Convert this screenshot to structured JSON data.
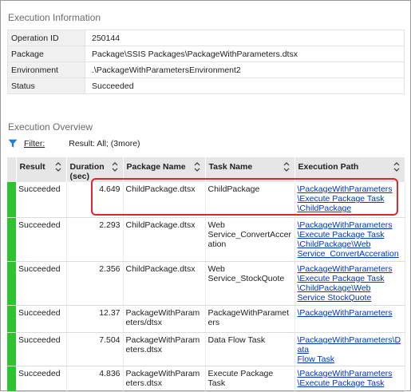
{
  "sections": {
    "info_title": "Execution Information",
    "overview_title": "Execution Overview"
  },
  "info": [
    {
      "key": "Operation ID",
      "value": "250144"
    },
    {
      "key": "Package",
      "value": "Package\\SSIS Packages\\PackageWithParameters.dtsx"
    },
    {
      "key": "Environment",
      "value": ".\\PackageWithParametersEnvironment2"
    },
    {
      "key": "Status",
      "value": "Succeeded"
    }
  ],
  "filter": {
    "icon": "filter-funnel-icon",
    "label": "Filter:",
    "value": "Result: All;  (3more)"
  },
  "grid": {
    "headers": [
      "Result",
      "Duration (sec)",
      "Package Name",
      "Task Name",
      "Execution Path"
    ],
    "rows": [
      {
        "result": "Succeeded",
        "duration": "4.649",
        "package": "ChildPackage.dtsx",
        "task": "ChildPackage",
        "path": [
          "\\PackageWithParameters",
          "\\Execute Package Task",
          "\\ChildPackage"
        ]
      },
      {
        "result": "Succeeded",
        "duration": "2.293",
        "package": "ChildPackage.dtsx",
        "task": "Web Service_ConvertAcceration",
        "path": [
          "\\PackageWithParameters",
          "\\Execute Package Task",
          "\\ChildPackage\\Web",
          "Service_ConvertAcceration"
        ]
      },
      {
        "result": "Succeeded",
        "duration": "2.356",
        "package": "ChildPackage.dtsx",
        "task": "Web Service_StockQuote",
        "path": [
          "\\PackageWithParameters",
          "\\Execute Package Task",
          "\\ChildPackage\\Web",
          "Service StockQuote"
        ]
      },
      {
        "result": "Succeeded",
        "duration": "12.37",
        "package": "PackageWithParameters/dtsx",
        "task": "PackageWithParameters",
        "path": [
          "\\PackageWithParameters"
        ]
      },
      {
        "result": "Succeeded",
        "duration": "7.504",
        "package": "PackageWithParameters.dtsx",
        "task": "Data Flow Task",
        "path": [
          "\\PackageWithParameters\\Data",
          "Flow Task"
        ]
      },
      {
        "result": "Succeeded",
        "duration": "4.836",
        "package": "PackageWithParameters.dtsx",
        "task": "Execute Package Task",
        "path": [
          "\\PackageWithParameters",
          "\\Execute Package Task"
        ]
      }
    ]
  },
  "colors": {
    "success": "#2fc32f",
    "highlight": "#d9282f",
    "link": "#0033cc",
    "filter_icon": "#1f7fd6"
  }
}
